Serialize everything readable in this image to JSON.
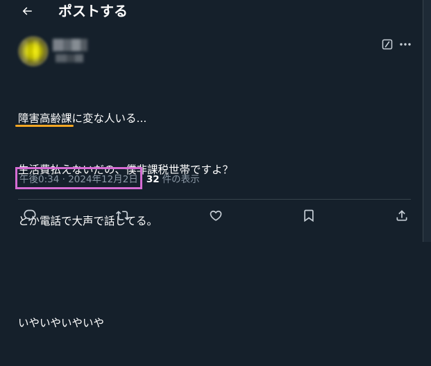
{
  "header": {
    "back_icon": "arrow-left-icon",
    "title": "ポストする"
  },
  "tweet": {
    "author": {
      "avatar": "blurred-avatar",
      "display_name": "",
      "handle": ""
    },
    "grok_icon": "grok-icon",
    "more_icon": "more-icon",
    "text": {
      "highlighted_word": "障害高齢課",
      "line1_rest": "に変な人いる...",
      "line2": "生活費払えないだの、僕非課税世帯ですよ？",
      "line3": "とか電話で大声で話してる。",
      "line4": "",
      "line5": "いやいやいやいや"
    },
    "timestamp": "午後0:34 · 2024年12月2日",
    "views_count": "32",
    "views_label": "件の表示",
    "actions": {
      "reply_icon": "reply-icon",
      "retweet_icon": "retweet-icon",
      "like_icon": "heart-icon",
      "bookmark_icon": "bookmark-icon",
      "share_icon": "share-icon"
    }
  },
  "colors": {
    "background": "#15202b",
    "text": "#ffffff",
    "secondary_text": "#8b98a5",
    "divider": "#38444d",
    "underline_annotation": "#f5a623",
    "box_annotation": "#d56cd3"
  }
}
